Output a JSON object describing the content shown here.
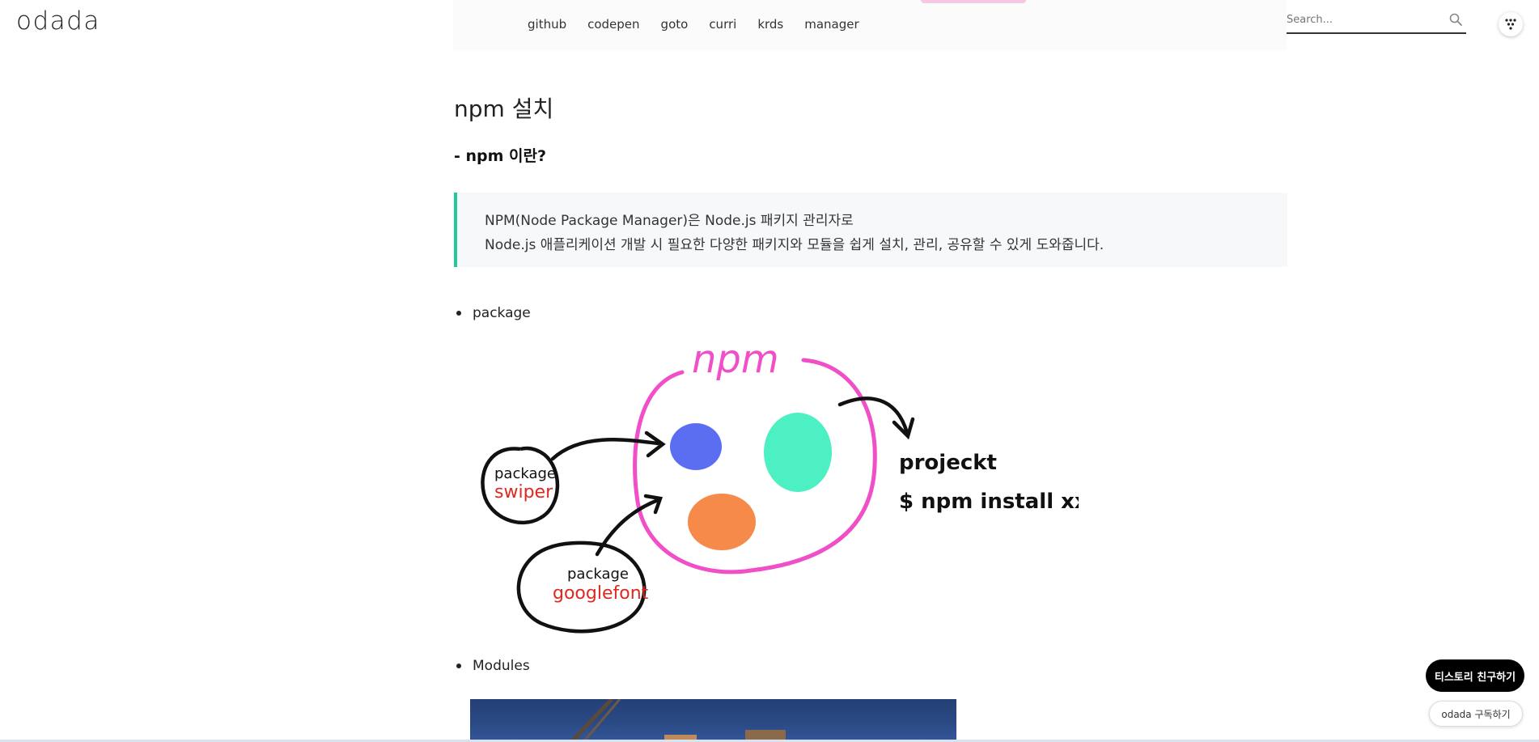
{
  "site": {
    "logo": "odada"
  },
  "nav": {
    "items": [
      "github",
      "codepen",
      "goto",
      "curri",
      "krds",
      "manager"
    ]
  },
  "search": {
    "placeholder": "Search..."
  },
  "article": {
    "title": "npm 설치",
    "subtitle": "- npm 이란?",
    "quote_lines": [
      "NPM(Node Package Manager)은 Node.js 패키지 관리자로",
      "Node.js 애플리케이션 개발 시 필요한 다양한 패키지와 모듈을 쉽게 설치, 관리, 공유할 수 있게 도와줍니다."
    ],
    "bullets": [
      "package",
      "Modules"
    ]
  },
  "diagram": {
    "npm_label": "npm",
    "package1_label": "package",
    "package1_name": "swiper",
    "package2_label": "package",
    "package2_name": "googlefont",
    "project_label": "projeckt",
    "command": "$ npm install xxx"
  },
  "colors": {
    "accent_quote": "#1fc99a",
    "npm_pink": "#f04fc8",
    "blob_blue": "#5b6ef2",
    "blob_green": "#4cf0c2",
    "blob_orange": "#f58a4a",
    "package_name_red": "#e0281f"
  },
  "floating": {
    "friend_button": "티스토리 친구하기",
    "subscribe_button": "odada 구독하기"
  }
}
